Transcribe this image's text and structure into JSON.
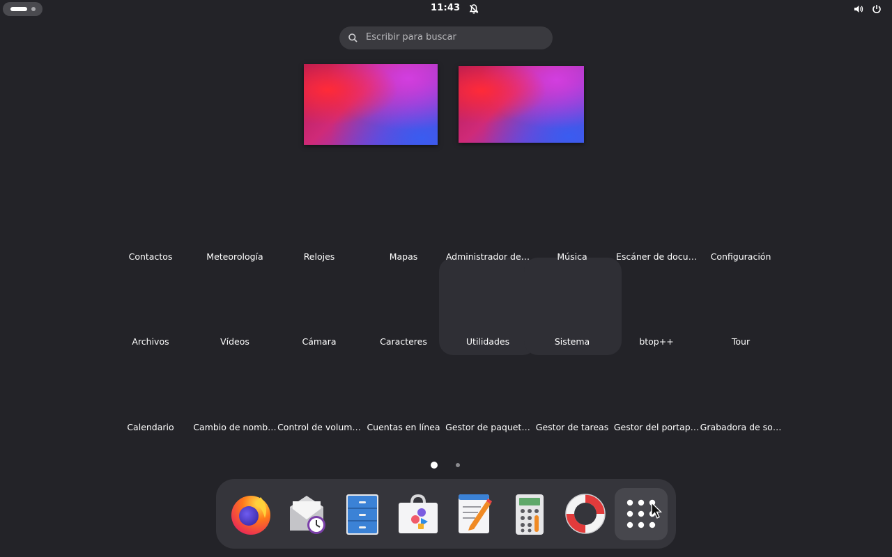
{
  "topbar": {
    "clock": "11:43"
  },
  "search": {
    "placeholder": "Escribir para buscar"
  },
  "workspaces": [
    {
      "name": "workspace-1"
    },
    {
      "name": "workspace-2"
    }
  ],
  "app_grid": {
    "row1": [
      "Contactos",
      "Meteorología",
      "Relojes",
      "Mapas",
      "Administrador de…",
      "Música",
      "Escáner de docu…",
      "Configuración"
    ],
    "row2": [
      "Archivos",
      "Vídeos",
      "Cámara",
      "Caracteres",
      "Utilidades",
      "Sistema",
      "btop++",
      "Tour"
    ],
    "row3": [
      "Calendario",
      "Cambio de nomb…",
      "Control de volum…",
      "Cuentas en línea",
      "Gestor de paquet…",
      "Gestor de tareas",
      "Gestor del portap…",
      "Grabadora de so…"
    ]
  },
  "pagination": {
    "pages": 2,
    "current": 1
  },
  "dock": {
    "apps": [
      {
        "icon": "firefox-icon"
      },
      {
        "icon": "mail-clock-icon"
      },
      {
        "icon": "files-cabinet-icon"
      },
      {
        "icon": "software-store-icon"
      },
      {
        "icon": "text-editor-icon"
      },
      {
        "icon": "calculator-icon"
      },
      {
        "icon": "help-lifebuoy-icon"
      },
      {
        "icon": "show-apps-grid-icon"
      }
    ]
  },
  "colors": {
    "background": "#232328",
    "accent": "#ffffff"
  }
}
